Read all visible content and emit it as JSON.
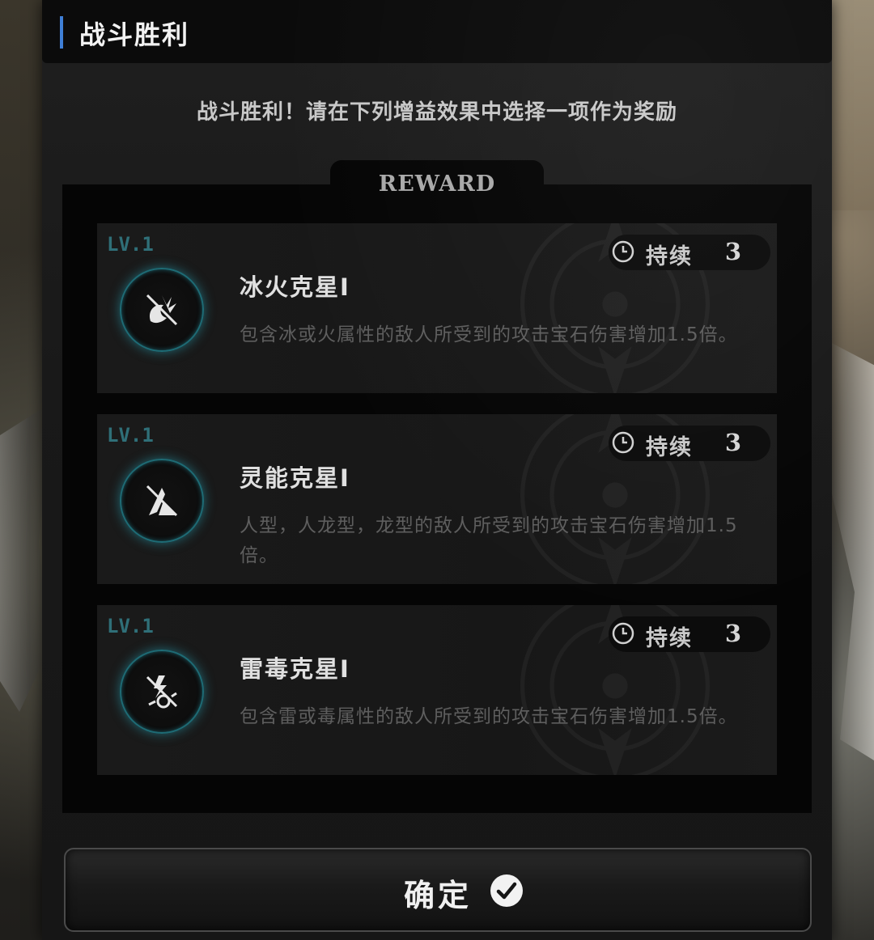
{
  "header": {
    "title": "战斗胜利"
  },
  "subtitle": "战斗胜利！请在下列增益效果中选择一项作为奖励",
  "reward_tab_label": "REWARD",
  "cards": [
    {
      "level": "LV.1",
      "name": "冰火克星Ⅰ",
      "description": "包含冰或火属性的敌人所受到的攻击宝石伤害增加1.5倍。",
      "duration_label": "持续",
      "duration_value": "3",
      "icon": "ice-fire-bane-icon"
    },
    {
      "level": "LV.1",
      "name": "灵能克星Ⅰ",
      "description": "人型，人龙型，龙型的敌人所受到的攻击宝石伤害增加1.5倍。",
      "duration_label": "持续",
      "duration_value": "3",
      "icon": "psionic-bane-icon"
    },
    {
      "level": "LV.1",
      "name": "雷毒克星Ⅰ",
      "description": "包含雷或毒属性的敌人所受到的攻击宝石伤害增加1.5倍。",
      "duration_label": "持续",
      "duration_value": "3",
      "icon": "thunder-poison-bane-icon"
    }
  ],
  "confirm_button": {
    "label": "确定",
    "icon": "checkmark-circle-icon"
  },
  "colors": {
    "accent_blue": "#3f7fd6",
    "level_teal": "#2f6f78",
    "icon_glow": "#28aabe"
  }
}
